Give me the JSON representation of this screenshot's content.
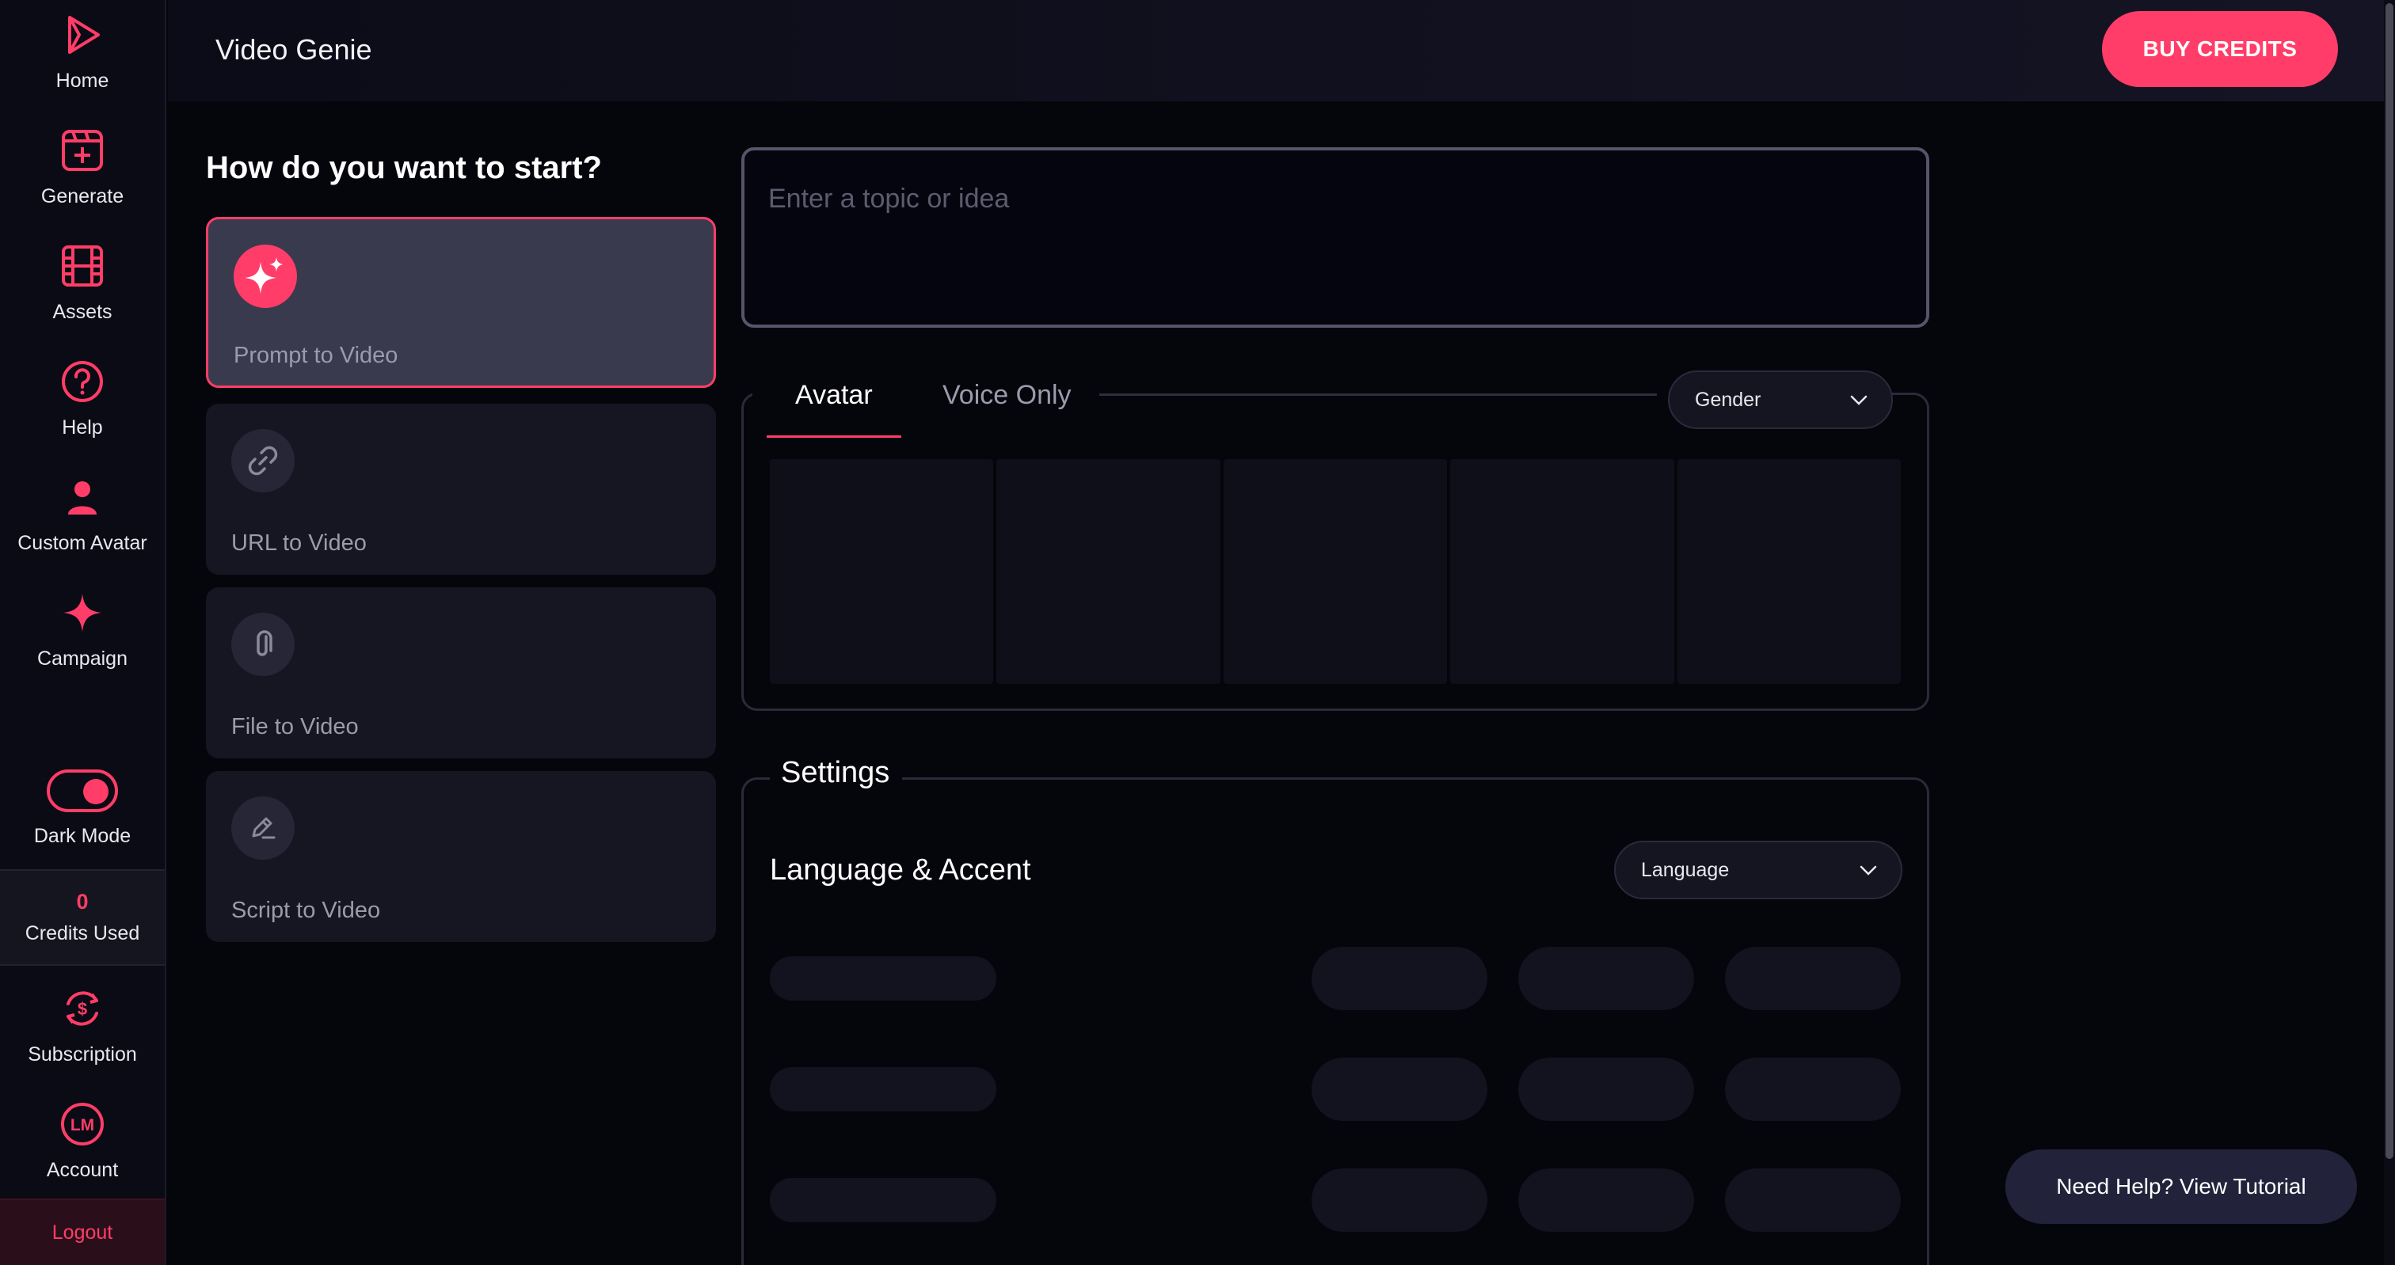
{
  "app": {
    "title": "Video Genie",
    "buy_credits": "BUY CREDITS"
  },
  "sidebar": {
    "items": [
      {
        "label": "Home",
        "icon": "play-icon"
      },
      {
        "label": "Generate",
        "icon": "generate-icon"
      },
      {
        "label": "Assets",
        "icon": "film-icon"
      },
      {
        "label": "Help",
        "icon": "question-icon"
      },
      {
        "label": "Custom Avatar",
        "icon": "user-icon"
      },
      {
        "label": "Campaign",
        "icon": "sparkle-icon"
      }
    ],
    "dark_mode_label": "Dark Mode",
    "dark_mode_on": true,
    "credits_value": "0",
    "credits_label": "Credits Used",
    "subscription_label": "Subscription",
    "account_label": "Account",
    "account_initials": "LM",
    "logout_label": "Logout"
  },
  "start": {
    "title": "How do you want to start?",
    "options": [
      {
        "label": "Prompt to Video",
        "icon": "sparkle-icon",
        "selected": true
      },
      {
        "label": "URL to Video",
        "icon": "link-icon",
        "selected": false
      },
      {
        "label": "File to Video",
        "icon": "paperclip-icon",
        "selected": false
      },
      {
        "label": "Script to Video",
        "icon": "pencil-icon",
        "selected": false
      }
    ]
  },
  "topic": {
    "placeholder": "Enter a topic or idea",
    "value": ""
  },
  "avatar_section": {
    "tabs": [
      {
        "label": "Avatar",
        "active": true
      },
      {
        "label": "Voice Only",
        "active": false
      }
    ],
    "gender_dropdown": "Gender"
  },
  "settings": {
    "title": "Settings",
    "language_title": "Language & Accent",
    "language_dropdown": "Language"
  },
  "help_button": "Need Help? View Tutorial",
  "colors": {
    "accent": "#ff3d68",
    "background": "#05050c",
    "card": "#161622"
  }
}
